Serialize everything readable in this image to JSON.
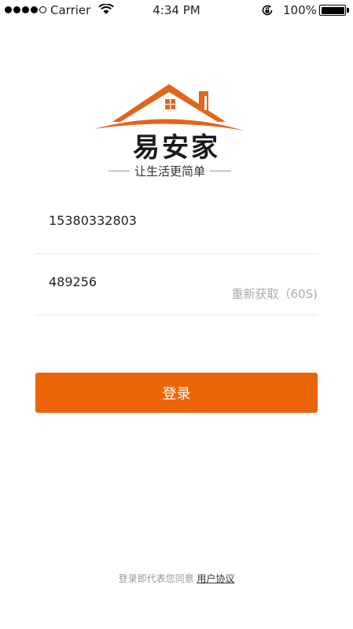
{
  "status_bar": {
    "carrier": "Carrier",
    "time": "4:34 PM",
    "battery": "100%"
  },
  "brand": {
    "name": "易安家",
    "slogan": "让生活更简单",
    "color": "#e2661a"
  },
  "form": {
    "phone_value": "15380332803",
    "code_value": "489256",
    "resend_label": "重新获取（60S)",
    "login_label": "登录",
    "button_color": "#eb6408"
  },
  "footer": {
    "prefix": "登录即代表您同意",
    "agreement_link": "用户协议"
  },
  "icons": [
    "signal-dots-icon",
    "wifi-icon",
    "rotation-lock-icon",
    "battery-icon",
    "house-roof-logo-icon"
  ]
}
